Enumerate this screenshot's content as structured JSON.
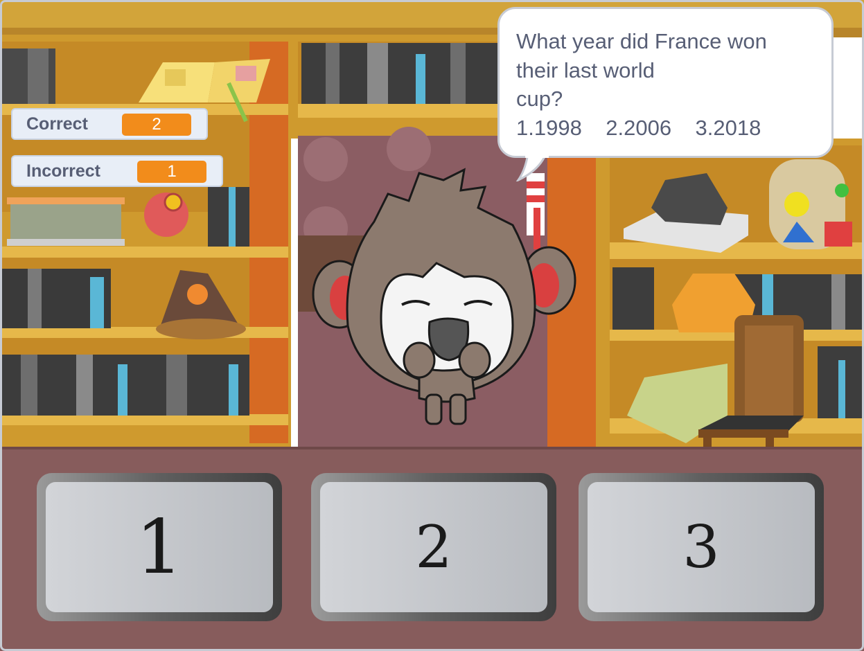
{
  "game": {
    "question": "What year did France won\ntheir last world\ncup?\n1.1998    2.2006    3.2018",
    "character": "monkey",
    "backdrop": "library-shelves"
  },
  "monitors": {
    "correct": {
      "label": "Correct",
      "value": "2"
    },
    "incorrect": {
      "label": "Incorrect",
      "value": "1"
    }
  },
  "buttons": [
    {
      "label": "1"
    },
    {
      "label": "2"
    },
    {
      "label": "3"
    }
  ],
  "colors": {
    "monitor_value_bg": "#f28c1b",
    "shelf_wood": "#cf9a2e",
    "wall_orange": "#d66a23",
    "floor": "#875c5c"
  }
}
